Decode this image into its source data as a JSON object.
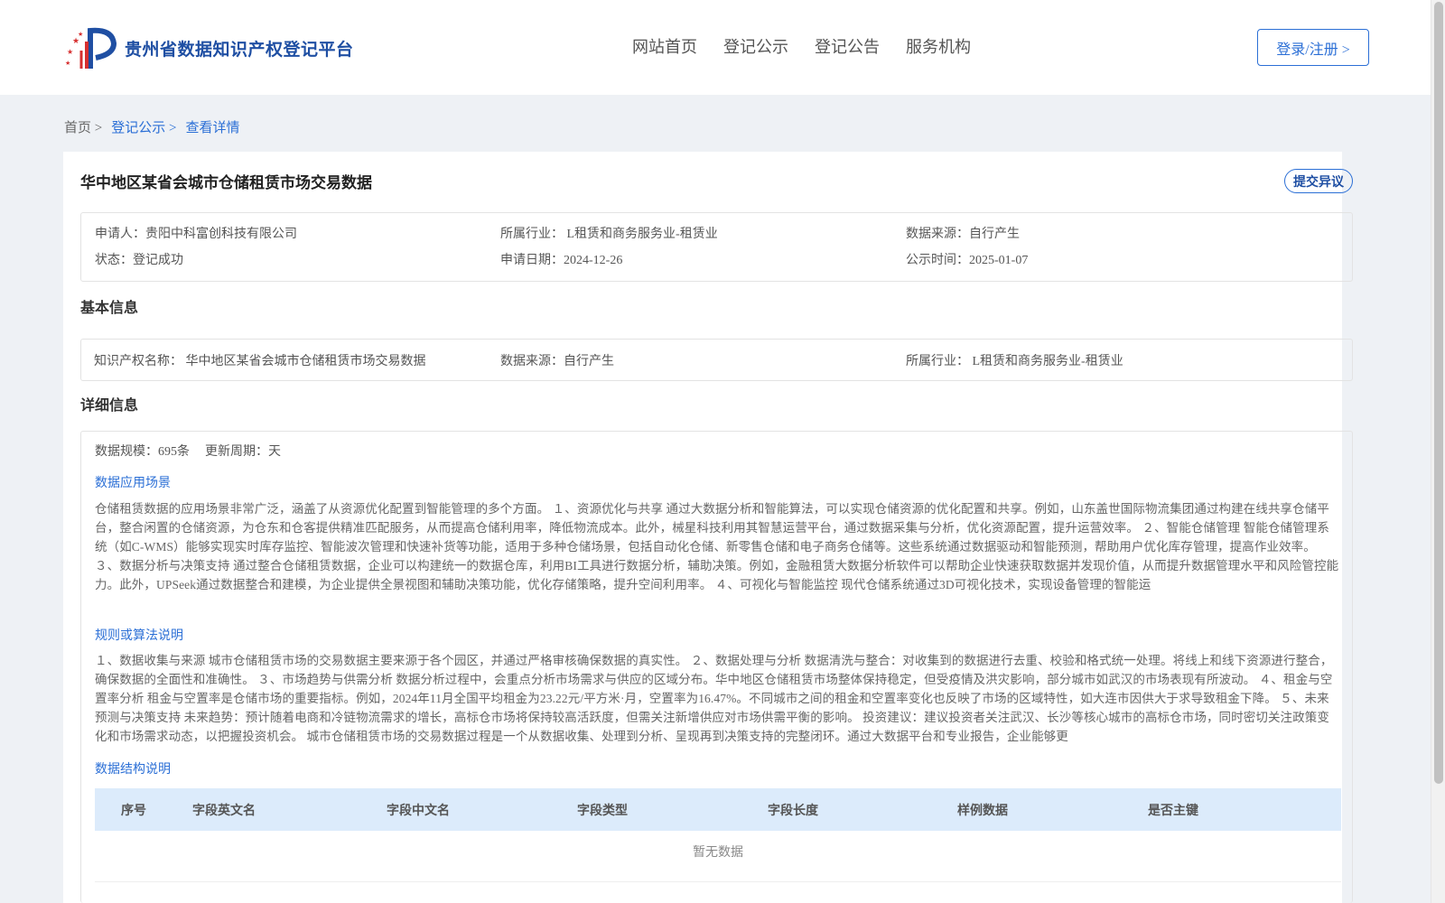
{
  "header": {
    "site_name": "贵州省数据知识产权登记平台",
    "nav": [
      "网站首页",
      "登记公示",
      "登记公告",
      "服务机构"
    ],
    "login_label": "登录/注册 >"
  },
  "breadcrumb": {
    "home": "首页 >",
    "public": "登记公示 >",
    "current": "查看详情"
  },
  "detail": {
    "title": "华中地区某省会城市仓储租赁市场交易数据",
    "objection_label": "提交异议",
    "summary": {
      "applicant": "申请人：贵阳中科富创科技有限公司",
      "industry": "所属行业： L租赁和商务服务业-租赁业",
      "source": "数据来源：自行产生",
      "status": "状态：登记成功",
      "apply_date": "申请日期：2024-12-26",
      "publish_date": "公示时间：2025-01-07"
    },
    "basic_title": "基本信息",
    "basic": {
      "ip_name": "知识产权名称： 华中地区某省会城市仓储租赁市场交易数据",
      "source": "数据来源：自行产生",
      "industry": "所属行业： L租赁和商务服务业-租赁业"
    },
    "detail_title": "详细信息",
    "scale": "数据规模：695条",
    "cycle": "更新周期：天",
    "scenario_title": "数据应用场景",
    "scenario_text": "仓储租赁数据的应用场景非常广泛，涵盖了从资源优化配置到智能管理的多个方面。 １、资源优化与共享 通过大数据分析和智能算法，可以实现仓储资源的优化配置和共享。例如，山东盖世国际物流集团通过构建在线共享仓储平台，整合闲置的仓储资源，为仓东和仓客提供精准匹配服务，从而提高仓储利用率，降低物流成本。此外，械星科技利用其智慧运营平台，通过数据采集与分析，优化资源配置，提升运营效率。 ２、智能仓储管理 智能仓储管理系统（如C-WMS）能够实现实时库存监控、智能波次管理和快速补货等功能，适用于多种仓储场景，包括自动化仓储、新零售仓储和电子商务仓储等。这些系统通过数据驱动和智能预测，帮助用户优化库存管理，提高作业效率。 ３、数据分析与决策支持 通过整合仓储租赁数据，企业可以构建统一的数据仓库，利用BI工具进行数据分析，辅助决策。例如，金融租赁大数据分析软件可以帮助企业快速获取数据并发现价值，从而提升数据管理水平和风险管控能力。此外，UPSeek通过数据整合和建模，为企业提供全景视图和辅助决策功能，优化存储策略，提升空间利用率。 ４、可视化与智能监控 现代仓储系统通过3D可视化技术，实现设备管理的智能运",
    "rule_title": "规则或算法说明",
    "rule_text": "１、数据收集与来源 城市仓储租赁市场的交易数据主要来源于各个园区，并通过严格审核确保数据的真实性。 ２、数据处理与分析 数据清洗与整合：对收集到的数据进行去重、校验和格式统一处理。将线上和线下资源进行整合，确保数据的全面性和准确性。 ３、市场趋势与供需分析 数据分析过程中，会重点分析市场需求与供应的区域分布。华中地区仓储租赁市场整体保持稳定，但受疫情及洪灾影响，部分城市如武汉的市场表现有所波动。 ４、租金与空置率分析 租金与空置率是仓储市场的重要指标。例如，2024年11月全国平均租金为23.22元/平方米·月，空置率为16.47%。不同城市之间的租金和空置率变化也反映了市场的区域特性，如大连市因供大于求导致租金下降。 ５、未来预测与决策支持 未来趋势：预计随着电商和冷链物流需求的增长，高标仓市场将保持较高活跃度，但需关注新增供应对市场供需平衡的影响。 投资建议：建议投资者关注武汉、长沙等核心城市的高标仓市场，同时密切关注政策变化和市场需求动态，以把握投资机会。 城市仓储租赁市场的交易数据过程是一个从数据收集、处理到分析、呈现再到决策支持的完整闭环。通过大数据平台和专业报告，企业能够更",
    "structure_title": "数据结构说明",
    "table_headers": [
      "序号",
      "字段英文名",
      "字段中文名",
      "字段类型",
      "字段长度",
      "样例数据",
      "是否主键"
    ],
    "empty_text": "暂无数据"
  },
  "colors": {
    "primary": "#2b6fd6",
    "brand": "#1f4fa3",
    "background": "#eef1f5",
    "table_header": "#dcebfb"
  }
}
